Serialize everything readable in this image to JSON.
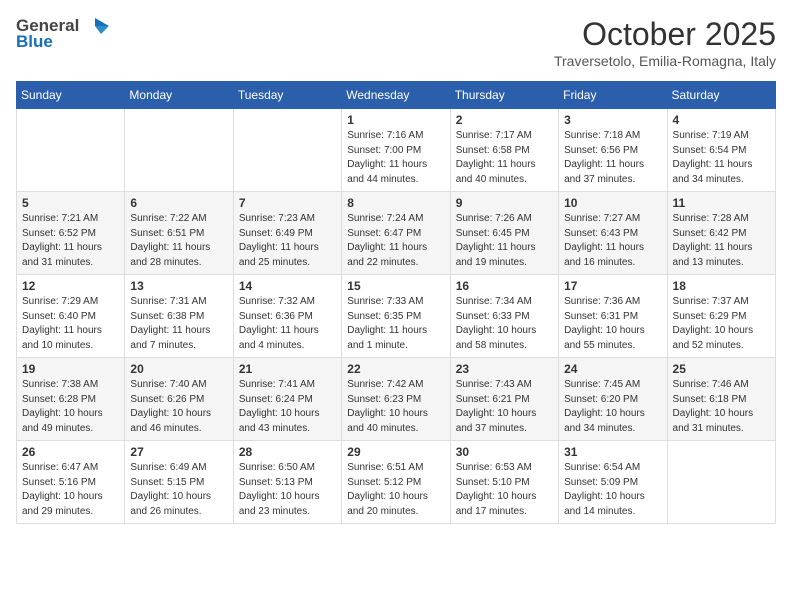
{
  "header": {
    "logo_general": "General",
    "logo_blue": "Blue",
    "month_title": "October 2025",
    "location": "Traversetolo, Emilia-Romagna, Italy"
  },
  "days_of_week": [
    "Sunday",
    "Monday",
    "Tuesday",
    "Wednesday",
    "Thursday",
    "Friday",
    "Saturday"
  ],
  "weeks": [
    [
      {
        "day": "",
        "info": ""
      },
      {
        "day": "",
        "info": ""
      },
      {
        "day": "",
        "info": ""
      },
      {
        "day": "1",
        "info": "Sunrise: 7:16 AM\nSunset: 7:00 PM\nDaylight: 11 hours and 44 minutes."
      },
      {
        "day": "2",
        "info": "Sunrise: 7:17 AM\nSunset: 6:58 PM\nDaylight: 11 hours and 40 minutes."
      },
      {
        "day": "3",
        "info": "Sunrise: 7:18 AM\nSunset: 6:56 PM\nDaylight: 11 hours and 37 minutes."
      },
      {
        "day": "4",
        "info": "Sunrise: 7:19 AM\nSunset: 6:54 PM\nDaylight: 11 hours and 34 minutes."
      }
    ],
    [
      {
        "day": "5",
        "info": "Sunrise: 7:21 AM\nSunset: 6:52 PM\nDaylight: 11 hours and 31 minutes."
      },
      {
        "day": "6",
        "info": "Sunrise: 7:22 AM\nSunset: 6:51 PM\nDaylight: 11 hours and 28 minutes."
      },
      {
        "day": "7",
        "info": "Sunrise: 7:23 AM\nSunset: 6:49 PM\nDaylight: 11 hours and 25 minutes."
      },
      {
        "day": "8",
        "info": "Sunrise: 7:24 AM\nSunset: 6:47 PM\nDaylight: 11 hours and 22 minutes."
      },
      {
        "day": "9",
        "info": "Sunrise: 7:26 AM\nSunset: 6:45 PM\nDaylight: 11 hours and 19 minutes."
      },
      {
        "day": "10",
        "info": "Sunrise: 7:27 AM\nSunset: 6:43 PM\nDaylight: 11 hours and 16 minutes."
      },
      {
        "day": "11",
        "info": "Sunrise: 7:28 AM\nSunset: 6:42 PM\nDaylight: 11 hours and 13 minutes."
      }
    ],
    [
      {
        "day": "12",
        "info": "Sunrise: 7:29 AM\nSunset: 6:40 PM\nDaylight: 11 hours and 10 minutes."
      },
      {
        "day": "13",
        "info": "Sunrise: 7:31 AM\nSunset: 6:38 PM\nDaylight: 11 hours and 7 minutes."
      },
      {
        "day": "14",
        "info": "Sunrise: 7:32 AM\nSunset: 6:36 PM\nDaylight: 11 hours and 4 minutes."
      },
      {
        "day": "15",
        "info": "Sunrise: 7:33 AM\nSunset: 6:35 PM\nDaylight: 11 hours and 1 minute."
      },
      {
        "day": "16",
        "info": "Sunrise: 7:34 AM\nSunset: 6:33 PM\nDaylight: 10 hours and 58 minutes."
      },
      {
        "day": "17",
        "info": "Sunrise: 7:36 AM\nSunset: 6:31 PM\nDaylight: 10 hours and 55 minutes."
      },
      {
        "day": "18",
        "info": "Sunrise: 7:37 AM\nSunset: 6:29 PM\nDaylight: 10 hours and 52 minutes."
      }
    ],
    [
      {
        "day": "19",
        "info": "Sunrise: 7:38 AM\nSunset: 6:28 PM\nDaylight: 10 hours and 49 minutes."
      },
      {
        "day": "20",
        "info": "Sunrise: 7:40 AM\nSunset: 6:26 PM\nDaylight: 10 hours and 46 minutes."
      },
      {
        "day": "21",
        "info": "Sunrise: 7:41 AM\nSunset: 6:24 PM\nDaylight: 10 hours and 43 minutes."
      },
      {
        "day": "22",
        "info": "Sunrise: 7:42 AM\nSunset: 6:23 PM\nDaylight: 10 hours and 40 minutes."
      },
      {
        "day": "23",
        "info": "Sunrise: 7:43 AM\nSunset: 6:21 PM\nDaylight: 10 hours and 37 minutes."
      },
      {
        "day": "24",
        "info": "Sunrise: 7:45 AM\nSunset: 6:20 PM\nDaylight: 10 hours and 34 minutes."
      },
      {
        "day": "25",
        "info": "Sunrise: 7:46 AM\nSunset: 6:18 PM\nDaylight: 10 hours and 31 minutes."
      }
    ],
    [
      {
        "day": "26",
        "info": "Sunrise: 6:47 AM\nSunset: 5:16 PM\nDaylight: 10 hours and 29 minutes."
      },
      {
        "day": "27",
        "info": "Sunrise: 6:49 AM\nSunset: 5:15 PM\nDaylight: 10 hours and 26 minutes."
      },
      {
        "day": "28",
        "info": "Sunrise: 6:50 AM\nSunset: 5:13 PM\nDaylight: 10 hours and 23 minutes."
      },
      {
        "day": "29",
        "info": "Sunrise: 6:51 AM\nSunset: 5:12 PM\nDaylight: 10 hours and 20 minutes."
      },
      {
        "day": "30",
        "info": "Sunrise: 6:53 AM\nSunset: 5:10 PM\nDaylight: 10 hours and 17 minutes."
      },
      {
        "day": "31",
        "info": "Sunrise: 6:54 AM\nSunset: 5:09 PM\nDaylight: 10 hours and 14 minutes."
      },
      {
        "day": "",
        "info": ""
      }
    ]
  ]
}
